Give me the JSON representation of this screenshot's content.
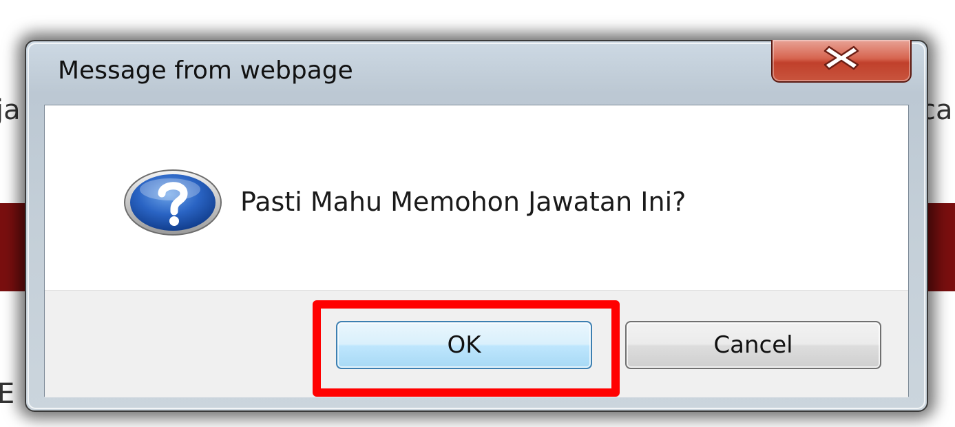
{
  "background": {
    "left_text": "ja",
    "right_text": "ca",
    "bottom_left_text": "E",
    "band_color": "#7a0f0f"
  },
  "dialog": {
    "title": "Message from webpage",
    "close_icon": "close-x-icon",
    "icon": "question-mark-icon",
    "message": "Pasti Mahu Memohon Jawatan Ini?",
    "buttons": {
      "ok": "OK",
      "cancel": "Cancel"
    },
    "highlight_color": "#ff0000"
  }
}
